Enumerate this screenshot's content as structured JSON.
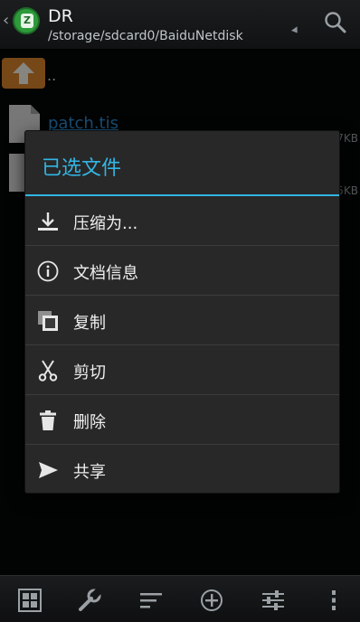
{
  "header": {
    "app_title": "DR",
    "path": "/storage/sdcard0/BaiduNetdisk",
    "app_icon_letter": "Z"
  },
  "file_list": {
    "parent_label": "..",
    "files": [
      {
        "name": "patch.tis",
        "size": "7KB"
      },
      {
        "name": "",
        "size": "5KB"
      }
    ]
  },
  "dialog": {
    "title": "已选文件",
    "items": [
      {
        "label": "压缩为...",
        "icon": "download-icon"
      },
      {
        "label": "文档信息",
        "icon": "info-icon"
      },
      {
        "label": "复制",
        "icon": "copy-icon"
      },
      {
        "label": "剪切",
        "icon": "scissors-icon"
      },
      {
        "label": "删除",
        "icon": "trash-icon"
      },
      {
        "label": "共享",
        "icon": "share-icon"
      }
    ]
  },
  "bottom_bar": {
    "icons": [
      "grid-icon",
      "wrench-icon",
      "sort-icon",
      "add-circle-icon",
      "sliders-icon",
      "more-vert-icon"
    ]
  },
  "colors": {
    "accent": "#33b5e5",
    "link": "#2f8fd3",
    "folder": "#d8822a",
    "app_icon": "#2d9b3a"
  }
}
